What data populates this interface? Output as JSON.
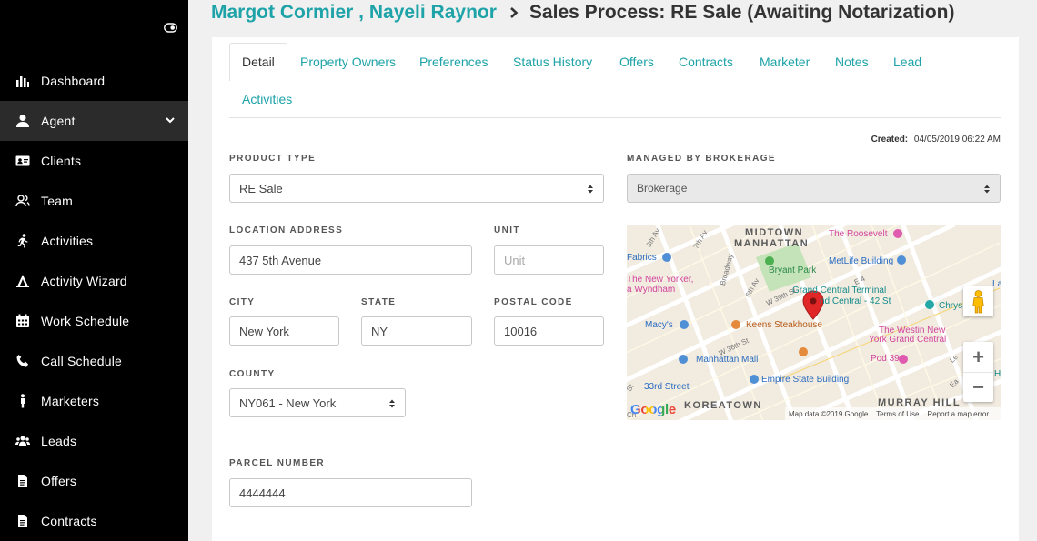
{
  "sidebar": {
    "items": [
      {
        "label": "Dashboard",
        "icon": "bar-chart-icon"
      },
      {
        "label": "Agent",
        "icon": "user-icon"
      },
      {
        "label": "Clients",
        "icon": "id-card-icon"
      },
      {
        "label": "Team",
        "icon": "people-icon"
      },
      {
        "label": "Activities",
        "icon": "running-person-icon"
      },
      {
        "label": "Activity Wizard",
        "icon": "wizard-icon"
      },
      {
        "label": "Work Schedule",
        "icon": "calendar-icon"
      },
      {
        "label": "Call Schedule",
        "icon": "phone-icon"
      },
      {
        "label": "Marketers",
        "icon": "person-standing-icon"
      },
      {
        "label": "Leads",
        "icon": "users-group-icon"
      },
      {
        "label": "Offers",
        "icon": "document-icon"
      },
      {
        "label": "Contracts",
        "icon": "document-icon"
      }
    ]
  },
  "header": {
    "client_names": "Margot Cormier , Nayeli Raynor",
    "page_title": "Sales Process: RE Sale (Awaiting Notarization)"
  },
  "tabs": [
    "Detail",
    "Property Owners",
    "Preferences",
    "Status History",
    "Offers",
    "Contracts",
    "Marketer",
    "Notes",
    "Lead",
    "Activities"
  ],
  "created": {
    "label": "Created:",
    "value": "04/05/2019 06:22 AM"
  },
  "form": {
    "product_type": {
      "label": "PRODUCT TYPE",
      "value": "RE Sale"
    },
    "managed_by": {
      "label": "MANAGED BY BROKERAGE",
      "value": "Brokerage"
    },
    "location_address": {
      "label": "LOCATION ADDRESS",
      "value": "437 5th Avenue"
    },
    "unit": {
      "label": "UNIT",
      "placeholder": "Unit"
    },
    "city": {
      "label": "CITY",
      "value": "New York"
    },
    "state": {
      "label": "STATE",
      "value": "NY"
    },
    "postal_code": {
      "label": "POSTAL CODE",
      "value": "10016"
    },
    "county": {
      "label": "COUNTY",
      "value": "NY061 - New York"
    },
    "parcel_number": {
      "label": "PARCEL NUMBER",
      "value": "4444444"
    }
  },
  "map": {
    "areas": [
      "MIDTOWN",
      "MANHATTAN",
      "KOREATOWN",
      "MURRAY HILL"
    ],
    "places": [
      "The Roosevelt",
      "Fabrics",
      "Bryant Park",
      "MetLife Building",
      "The New Yorker,",
      "a Wyndham",
      "Grand Central Terminal",
      "nd Central - 42 St",
      "Chrys",
      "Macy's",
      "Keens Steakhouse",
      "The Westin New",
      "York Grand Central",
      "Pod 39",
      "Manhattan Mall",
      "Empire State Building",
      "33rd Street",
      "Lap",
      "H"
    ],
    "streets": [
      "8th Av",
      "7th Av",
      "Broadway",
      "6th Av",
      "W 39th St",
      "W 36th St",
      "E 4",
      "Le",
      "Ea",
      "St",
      "Ch"
    ],
    "zoom_in": "+",
    "zoom_out": "−",
    "google": "Google",
    "attribution": [
      "Map data ©2019 Google",
      "Terms of Use",
      "Report a map error"
    ]
  }
}
